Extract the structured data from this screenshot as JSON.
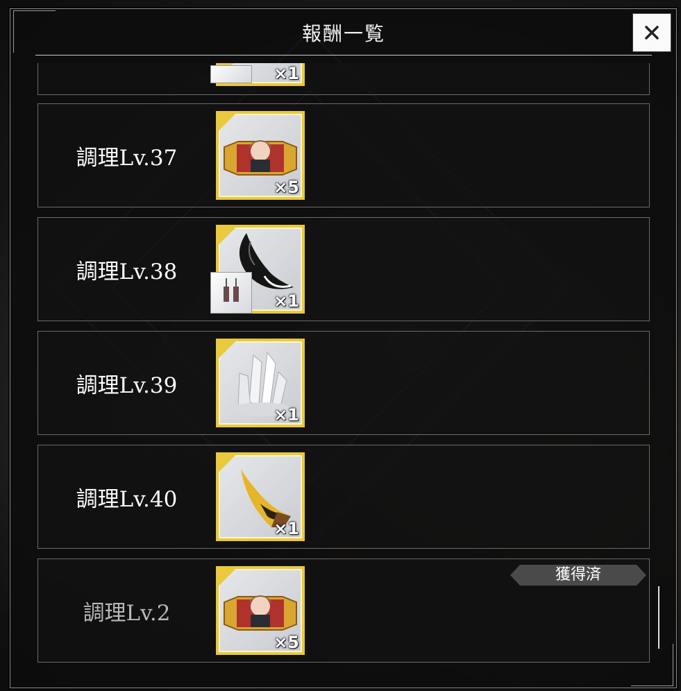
{
  "header": {
    "title": "報酬一覧",
    "close_icon": "close-icon"
  },
  "rows": [
    {
      "label": "調理Lv.37",
      "qty": "×5",
      "item_icon": "ticket-character-icon",
      "obtained": false
    },
    {
      "label": "調理Lv.38",
      "qty": "×1",
      "item_icon": "black-tail-accessory-icon",
      "sub_icon": "earring-icon",
      "obtained": false
    },
    {
      "label": "調理Lv.39",
      "qty": "×1",
      "item_icon": "crystal-cluster-icon",
      "obtained": false
    },
    {
      "label": "調理Lv.40",
      "qty": "×1",
      "item_icon": "golden-horn-icon",
      "obtained": false
    },
    {
      "label": "調理Lv.2",
      "qty": "×5",
      "item_icon": "ticket-character-icon",
      "obtained": true,
      "obtained_label": "獲得済"
    }
  ],
  "partial_row": {
    "qty": "×1"
  },
  "colors": {
    "tile_border": "#e9c93d",
    "panel_bg": "#0c0c0c",
    "badge_bg": "#4a4a4a"
  }
}
